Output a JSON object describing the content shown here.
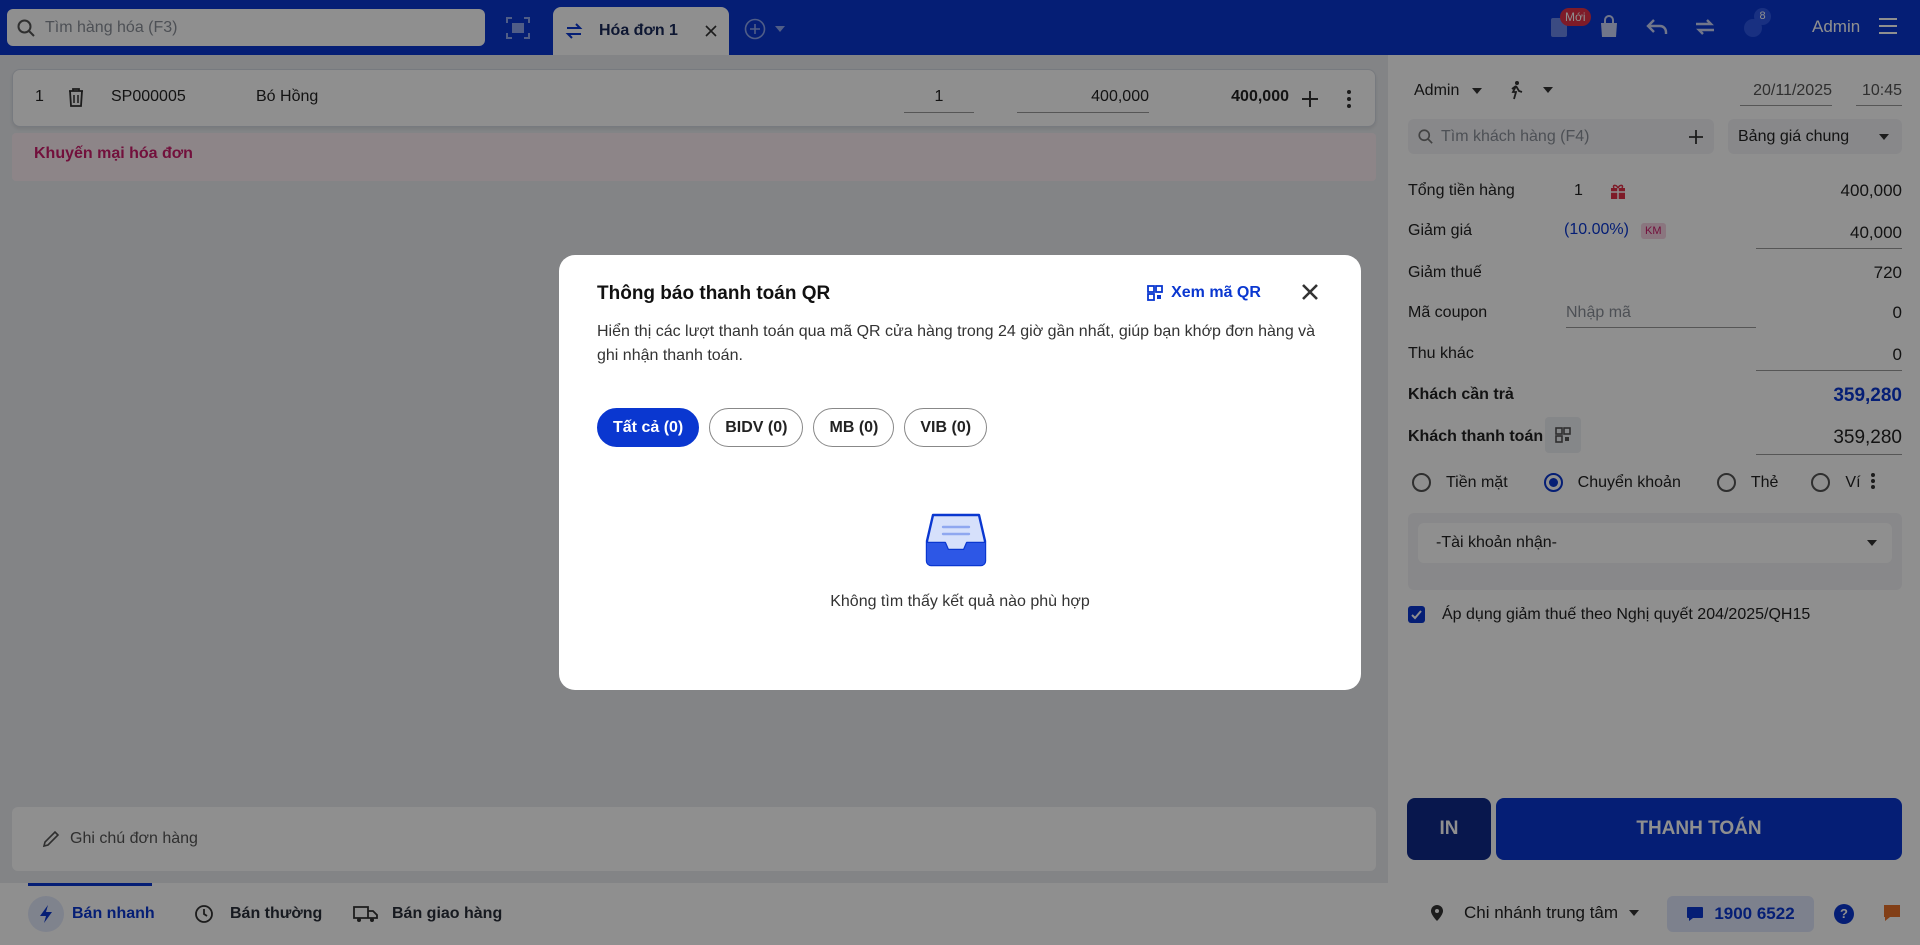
{
  "topbar": {
    "search_placeholder": "Tìm hàng hóa (F3)",
    "tab_label": "Hóa đơn 1",
    "new_badge": "Mới",
    "notif_count": "8",
    "user": "Admin"
  },
  "cart": {
    "rows": [
      {
        "index": "1",
        "code": "SP000005",
        "name": "Bó Hồng",
        "qty": "1",
        "price": "400,000",
        "total": "400,000"
      }
    ],
    "promo_label": "Khuyến mại hóa đơn",
    "note_placeholder": "Ghi chú đơn hàng"
  },
  "bottom": {
    "modes": [
      "Bán nhanh",
      "Bán thường",
      "Bán giao hàng"
    ],
    "branch": "Chi nhánh trung tâm",
    "hotline": "1900 6522"
  },
  "right": {
    "seller": "Admin",
    "date": "20/11/2025",
    "time": "10:45",
    "customer_placeholder": "Tìm khách hàng (F4)",
    "price_book": "Bảng giá chung",
    "subtotal_label": "Tổng tiền hàng",
    "subtotal_count": "1",
    "subtotal_value": "400,000",
    "discount_label": "Giảm giá",
    "discount_pct": "(10.00%)",
    "discount_tag": "KM",
    "discount_value": "40,000",
    "tax_label": "Giảm thuế",
    "tax_value": "720",
    "coupon_label": "Mã coupon",
    "coupon_placeholder": "Nhập mã",
    "coupon_value": "0",
    "other_label": "Thu khác",
    "other_value": "0",
    "due_label": "Khách cần trả",
    "due_value": "359,280",
    "paid_label": "Khách thanh toán",
    "paid_value": "359,280",
    "methods": [
      "Tiền mặt",
      "Chuyển khoản",
      "Thẻ",
      "Ví"
    ],
    "selected_method": "Chuyển khoản",
    "account_placeholder": "-Tài khoản nhận-",
    "tax_policy": "Áp dụng giảm thuế theo Nghị quyết 204/2025/QH15",
    "print_label": "IN",
    "pay_label": "THANH TOÁN"
  },
  "modal": {
    "title": "Thông báo thanh toán QR",
    "view_qr": "Xem mã QR",
    "description": "Hiển thị các lượt thanh toán qua mã QR cửa hàng trong 24 giờ gần nhất, giúp bạn khớp đơn hàng và ghi nhận thanh toán.",
    "filters": [
      "Tất cả (0)",
      "BIDV (0)",
      "MB (0)",
      "VIB (0)"
    ],
    "empty_text": "Không tìm thấy kết quả nào phù hợp"
  },
  "colors": {
    "primary": "#0a37d0",
    "promo": "#cc1d6b",
    "danger": "#e03048"
  }
}
